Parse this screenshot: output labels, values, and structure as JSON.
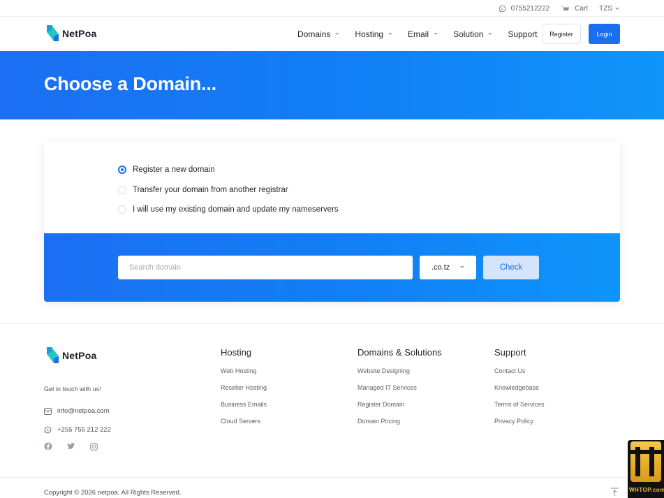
{
  "topbar": {
    "phone": "0755212222",
    "cart_label": "Cart",
    "currency": "TZS"
  },
  "header": {
    "logo_text": "NetPoa",
    "nav": [
      {
        "label": "Domains"
      },
      {
        "label": "Hosting"
      },
      {
        "label": "Email"
      },
      {
        "label": "Solution"
      },
      {
        "label": "Support"
      }
    ],
    "register_label": "Register",
    "login_label": "Login"
  },
  "hero": {
    "title": "Choose a Domain..."
  },
  "domain_form": {
    "options": [
      {
        "label": "Register a new domain",
        "selected": true
      },
      {
        "label": "Transfer your domain from another registrar",
        "selected": false
      },
      {
        "label": "I will use my existing domain and update my nameservers",
        "selected": false
      }
    ],
    "search_placeholder": "Search domain",
    "search_value": "",
    "tld_selected": ".co.tz",
    "check_label": "Check"
  },
  "footer": {
    "logo_text": "NetPoa",
    "get_in_touch": "Get in touch with us!",
    "email": "info@netpoa.com",
    "phone": "+255 755 212 222",
    "social_icons": [
      "facebook-icon",
      "twitter-icon",
      "instagram-icon"
    ],
    "columns": [
      {
        "heading": "Hosting",
        "links": [
          "Web Hosting",
          "Reseller Hosting",
          "Business Emails",
          "Cloud Servers"
        ]
      },
      {
        "heading": "Domains & Solutions",
        "links": [
          "Website Designing",
          "Managed IT Services",
          "Register Domain",
          "Domain Pricing"
        ]
      },
      {
        "heading": "Support",
        "links": [
          "Contact Us",
          "Knowledgebase",
          "Terms of Services",
          "Privacy Policy"
        ]
      }
    ],
    "copyright": "Copyright © 2026 netpoa. All Rights Reserved."
  },
  "watermark": {
    "text": "WHTOP.com"
  },
  "colors": {
    "primary": "#1a6fef",
    "hero_gradient_start": "#1b6ff2",
    "hero_gradient_end": "#0f95fb",
    "logo_teal": "#26c6c6"
  }
}
